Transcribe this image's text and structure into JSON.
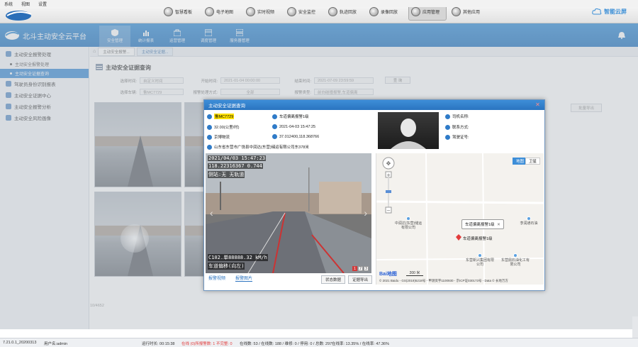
{
  "menubar": [
    "系统",
    "视图",
    "设置"
  ],
  "toolbar": {
    "modules": [
      {
        "label": "智慧看板",
        "icon": "dashboard-icon"
      },
      {
        "label": "电子地图",
        "icon": "map-icon"
      },
      {
        "label": "实时视频",
        "icon": "video-icon"
      },
      {
        "label": "安全监控",
        "icon": "shield-icon"
      },
      {
        "label": "轨迹回放",
        "icon": "track-icon"
      },
      {
        "label": "录像回放",
        "icon": "playback-icon"
      },
      {
        "label": "应用管理",
        "icon": "app-icon"
      },
      {
        "label": "其他应用",
        "icon": "more-icon"
      }
    ],
    "active_module": 6,
    "brand": "智能云屏"
  },
  "app": {
    "title": "北斗主动安全云平台",
    "nav": [
      {
        "label": "安全管理",
        "icon": "shield-icon"
      },
      {
        "label": "统计报表",
        "icon": "chart-icon"
      },
      {
        "label": "运营管理",
        "icon": "briefcase-icon"
      },
      {
        "label": "调度管理",
        "icon": "calendar-icon"
      },
      {
        "label": "服务器管理",
        "icon": "server-icon"
      }
    ],
    "active_nav": 0
  },
  "sidebar": {
    "items": [
      {
        "label": "主动安全报警处理",
        "children": [
          "主动安全报警处理",
          "主动安全证据查询"
        ],
        "active_child": 1
      },
      {
        "label": "驾驶员身份识别报表",
        "children": []
      },
      {
        "label": "主动安全证据中心",
        "children": []
      },
      {
        "label": "主动安全报警分析",
        "children": []
      },
      {
        "label": "主动安全风险画像",
        "children": []
      }
    ]
  },
  "breadcrumb": [
    "主动安全报警...",
    "主动安全证据..."
  ],
  "page": {
    "title": "主动安全证据查询",
    "filters": [
      {
        "label": "选择时间:",
        "value": "自定义时间"
      },
      {
        "label": "开始时间:",
        "value": "2021-01-04 00:00:00"
      },
      {
        "label": "结束时间:",
        "value": "2021-07-09 23:59:59"
      },
      {
        "label": "选择车辆:",
        "value": "鲁MC7729"
      },
      {
        "label": "报警处理方式:",
        "value": "全部"
      },
      {
        "label": "报警类型:",
        "value": "前向碰撞报警,车道偏离"
      }
    ],
    "query_button": "查 询",
    "export_button": "批量导出",
    "record_count": "10/4652"
  },
  "modal": {
    "title": "主动安全证据查询",
    "plate": "鲁MC7729",
    "alarm_type": "车道偏离报警1级",
    "speed": "32.00(公里/时)",
    "time": "2021-04-03 15:47:25",
    "company": "京博物流",
    "coords": "37.012400,118.368766",
    "address": "山东省东营市广饶县中润达(东营)储运有限公司东378米",
    "driver_name_label": "司机名称:",
    "contact_label": "联系方式:",
    "license_label": "驾驶证号:",
    "video_osd": {
      "line1": "2021/04/03 15:47:23",
      "line2": "118.22316367 0.744",
      "line3": "侧站:无 无轨道",
      "line4": "C102.单88888.32 kM/h",
      "line5": "车道偏移(向左)"
    },
    "video_pages": [
      "1",
      "2",
      "3"
    ],
    "tabs": [
      "报警视频",
      "报警图片"
    ],
    "active_tab": 1,
    "status_button": "状态数据",
    "export_button": "证据导出",
    "map": {
      "buttons": [
        "地图",
        "卫星"
      ],
      "callout": "车道偏离报警1级",
      "marker_label": "车道偏离报警1级",
      "pois": [
        "中润达(东营)储运有限公司",
        "东营新兴集团有限公司",
        "东营鼎石油化工有限公司",
        "李润通石油"
      ],
      "scale": "200 米",
      "logo": "Bai地图",
      "copyright": "© 2021 Baidu - GS(2019)5218号 - 甲测资字1100930 - 京ICP证030173号 - Data © 长地万方"
    }
  },
  "status": {
    "version": "7.21.0.1_20200313",
    "user": "用户名:admin",
    "runtime": "运行时长: 00:15:38",
    "online_alarm": "在线 (0)所报警数: 1",
    "unhandled": "不完整: 0",
    "online": "在线数: 53 / 在线数: 188 / 维修: 0 / 停用: 0 / 总数: 297",
    "rates": "在线率: 13.35% / 在线率: 47.36%"
  },
  "colors": {
    "accent": "#2f8bd6",
    "header_dark": "#1f72bf",
    "alarm_red": "#e23b3b",
    "plate_yellow": "#ffe100"
  }
}
